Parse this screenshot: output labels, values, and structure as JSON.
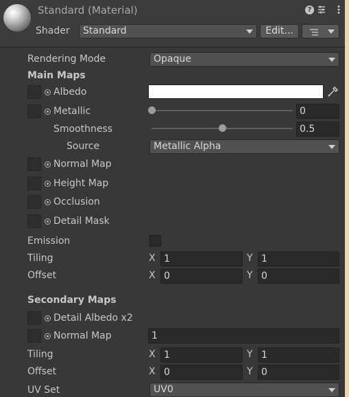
{
  "header": {
    "title": "Standard (Material)",
    "shader_label": "Shader",
    "shader_value": "Standard",
    "edit_button": "Edit...",
    "icons": [
      "help-icon",
      "preset-icon",
      "more-icon",
      "list-icon"
    ]
  },
  "rendering_mode": {
    "label": "Rendering Mode",
    "value": "Opaque"
  },
  "main_maps": {
    "heading": "Main Maps",
    "albedo": {
      "label": "Albedo",
      "color": "#FFFFFF"
    },
    "metallic": {
      "label": "Metallic",
      "value": "0",
      "level": 0
    },
    "smoothness": {
      "label": "Smoothness",
      "value": "0.5",
      "level": 0.5
    },
    "source": {
      "label": "Source",
      "value": "Metallic Alpha"
    },
    "normal_map": "Normal Map",
    "height_map": "Height Map",
    "occlusion": "Occlusion",
    "detail_mask": "Detail Mask",
    "emission": "Emission",
    "tiling": {
      "label": "Tiling",
      "x_label": "X",
      "x": "1",
      "y_label": "Y",
      "y": "1"
    },
    "offset": {
      "label": "Offset",
      "x_label": "X",
      "x": "0",
      "y_label": "Y",
      "y": "0"
    }
  },
  "secondary_maps": {
    "heading": "Secondary Maps",
    "detail_albedo": "Detail Albedo x2",
    "normal_map": {
      "label": "Normal Map",
      "value": "1"
    },
    "tiling": {
      "label": "Tiling",
      "x_label": "X",
      "x": "1",
      "y_label": "Y",
      "y": "1"
    },
    "offset": {
      "label": "Offset",
      "x_label": "X",
      "x": "0",
      "y_label": "Y",
      "y": "0"
    },
    "uv_set": {
      "label": "UV Set",
      "value": "UV0"
    }
  }
}
